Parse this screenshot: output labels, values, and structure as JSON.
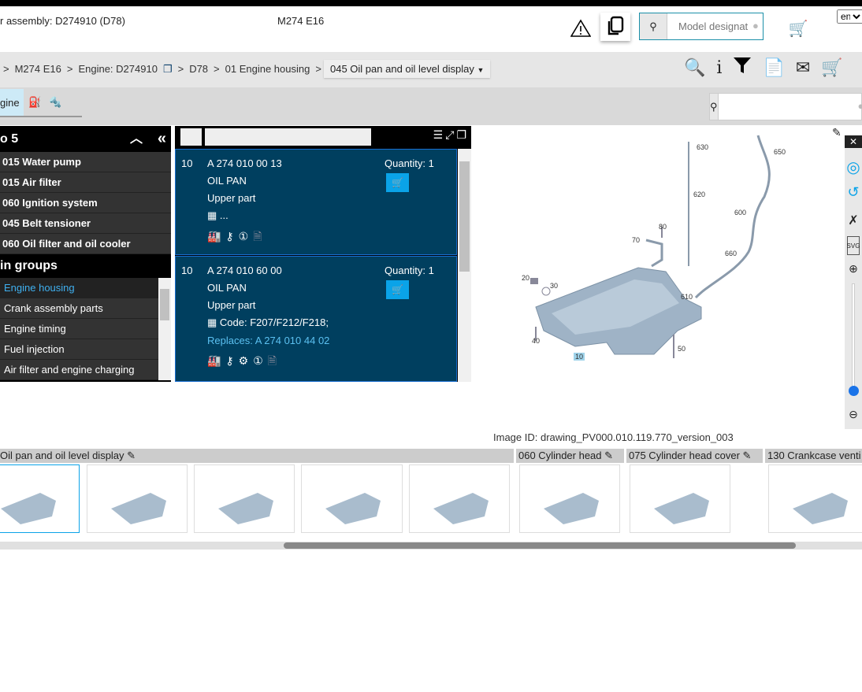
{
  "header": {
    "assembly": "r assembly: D274910 (D78)",
    "model": "M274 E16",
    "search_placeholder": "Model designat",
    "language": "en"
  },
  "breadcrumb": {
    "items": [
      "M274 E16",
      "Engine: D274910",
      "D78",
      "01 Engine housing"
    ],
    "current": "045 Oil pan and oil level display"
  },
  "tabs": {
    "active": "gine"
  },
  "recent": {
    "title": "o 5",
    "items": [
      "015 Water pump",
      "015 Air filter",
      "060 Ignition system",
      "045 Belt tensioner",
      "060 Oil filter and oil cooler"
    ]
  },
  "groups": {
    "title": "in groups",
    "items": [
      "Engine housing",
      "Crank assembly parts",
      "Engine timing",
      "Fuel injection",
      "Air filter and engine charging"
    ],
    "selected": 0
  },
  "parts": [
    {
      "pos": "10",
      "number": "A 274 010 00 13",
      "name": "OIL PAN",
      "desc": "Upper part",
      "code": "...",
      "replaces": "",
      "quantity": "Quantity: 1"
    },
    {
      "pos": "10",
      "number": "A 274 010 60 00",
      "name": "OIL PAN",
      "desc": "Upper part",
      "code": "Code: F207/F212/F218;",
      "replaces": "Replaces: A 274 010 44 02",
      "quantity": "Quantity: 1"
    }
  ],
  "drawing": {
    "callouts": [
      "630",
      "650",
      "620",
      "600",
      "80",
      "70",
      "660",
      "20",
      "30",
      "610",
      "40",
      "50",
      "10"
    ],
    "image_id": "Image ID: drawing_PV000.010.119.770_version_003",
    "zoom_level": 0.05
  },
  "thumbnails": {
    "groups": [
      "Oil pan and oil level display",
      "060 Cylinder head",
      "075 Cylinder head cover",
      "130 Crankcase venti"
    ]
  },
  "colors": {
    "accent": "#0aa3e8",
    "part_bg": "#003f5f",
    "link": "#5bc0f0"
  }
}
